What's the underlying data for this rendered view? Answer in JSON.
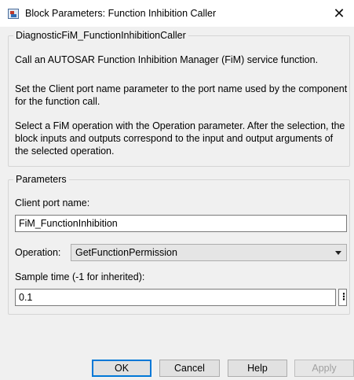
{
  "window": {
    "title": "Block Parameters: Function Inhibition Caller",
    "close_glyph": "✕",
    "icon": "simulink-block-icon"
  },
  "description": {
    "group_title": "DiagnosticFiM_FunctionInhibitionCaller",
    "paragraphs": [
      "Call an AUTOSAR Function Inhibition Manager (FiM) service function.",
      "Set the Client port name parameter to the port name used by the component for the function call.",
      "Select a FiM operation with the Operation parameter.  After the selection, the block inputs and outputs correspond to the input and output arguments of the selected operation."
    ]
  },
  "parameters": {
    "group_title": "Parameters",
    "client_port": {
      "label": "Client port name:",
      "value": "FiM_FunctionInhibition"
    },
    "operation": {
      "label": "Operation:",
      "selected": "GetFunctionPermission"
    },
    "sample_time": {
      "label": "Sample time (-1 for inherited):",
      "value": "0.1",
      "menu_glyph": "⋮"
    }
  },
  "buttons": {
    "ok": "OK",
    "cancel": "Cancel",
    "help": "Help",
    "apply": "Apply"
  }
}
